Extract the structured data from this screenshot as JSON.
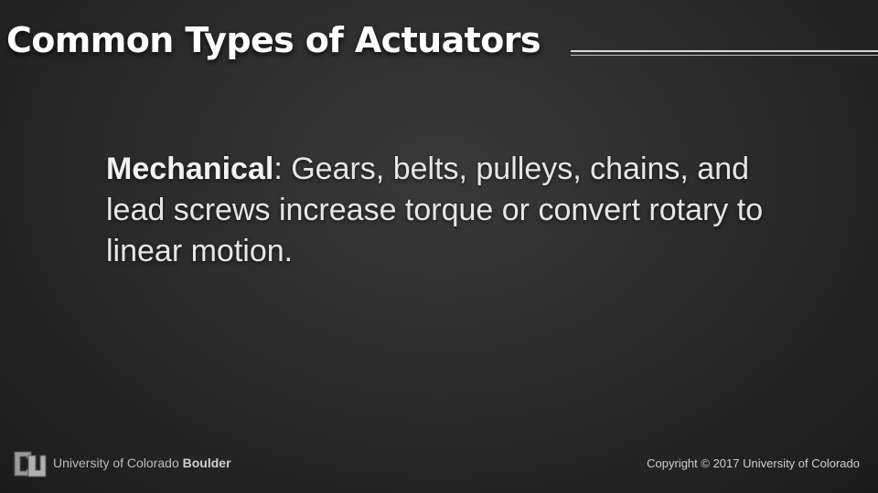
{
  "slide": {
    "title": "Common Types of Actuators",
    "body": {
      "term": "Mechanical",
      "separator": ":",
      "text": " Gears, belts, pulleys, chains, and lead screws increase torque or convert rotary to linear motion."
    }
  },
  "footer": {
    "logo_icon": "cu-logo-icon",
    "university_prefix": "University of Colorado ",
    "university_campus": "Boulder",
    "copyright": "Copyright © 2017 University of Colorado"
  },
  "colors": {
    "background": "#2c2c2c",
    "title_text": "#ffffff",
    "body_text": "#e6e6e6",
    "rule": "#d8d8d8",
    "footer_text": "#bdbdbd"
  }
}
